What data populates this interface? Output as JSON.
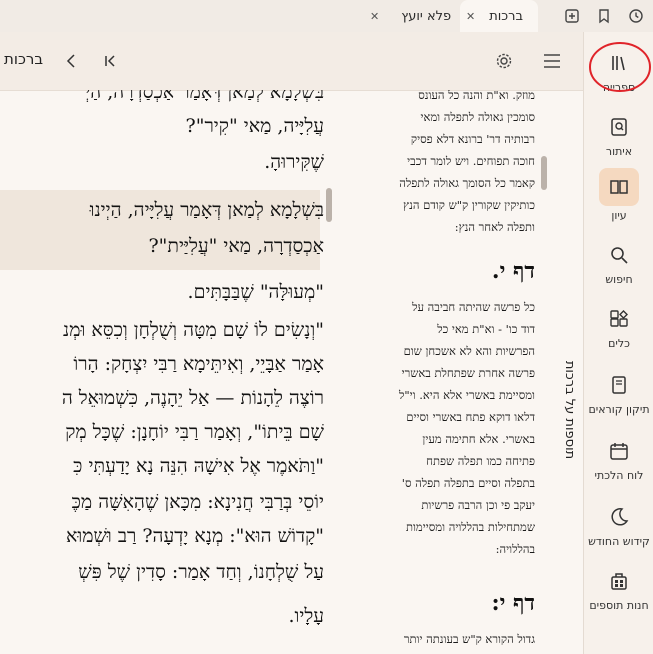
{
  "tabs": [
    {
      "title": "פלא יועץ"
    },
    {
      "title": "ברכות"
    }
  ],
  "toolbar": {
    "book_title": "ברכות"
  },
  "sidebar": {
    "items": [
      {
        "label": "ספרייה",
        "icon": "library-icon"
      },
      {
        "label": "איתור",
        "icon": "locate-icon"
      },
      {
        "label": "עיון",
        "icon": "open-book-icon"
      },
      {
        "label": "חיפוש",
        "icon": "search-icon"
      },
      {
        "label": "כלים",
        "icon": "tools-icon"
      },
      {
        "label": "תיקון קוראים",
        "icon": "scroll-book-icon"
      },
      {
        "label": "לוח הלכתי",
        "icon": "calendar-icon"
      },
      {
        "label": "קידוש החודש",
        "icon": "moon-icon"
      },
      {
        "label": "חנות תוספים",
        "icon": "store-icon"
      }
    ]
  },
  "commentary_panel": {
    "vertical_title": "תוספות על ברכות"
  },
  "main_text": {
    "lines": [
      "בִּשְׁלָמָא לְמַאן דְּאָמַר אַכְסַדְרָה, הַיְ",
      "עֲלִיָּיה, מַאי \"קִיר\"?",
      "שֶׁקִּירוּהָ.",
      "בִּשְׁלָמָא לְמַאן דְּאָמַר עֲלִיָּיה, הַיְינוּ",
      "אַכְסַדְרָה, מַאי \"עֲלִיַּית\"?",
      "\"מְעוּלָּה\" שֶׁבַּבָּתִּים.",
      "\"וְנָשִׂים לוֹ שָׁם מִטָּה וְשֻׁלְחָן וְכִסֵּא וּמְנ",
      "אָמַר אַבָּיֵי, וְאִיתֵּימָא רַבִּי יִצְחָק: הָרוֹ",
      "רוֹצֶה לֵהָנוֹת — אַל יֵהָנֶה, כִּשְׁמוּאֵל ה",
      "שָׁם בֵּיתוֹ\", וְאָמַר רַבִּי יוֹחָנָן: שֶׁכָּל מְק",
      "\"וַתֹּאמֶר אֶל אִישָׁהּ הִנֵּה נָא יָדַעְתִּי כִּ",
      "יוֹסֵי בְּרַבִּי חֲנִינָא: מִכָּאן שֶׁהָאִשָּׁה מַכֶּ",
      "\"קָדוֹשׁ הוּא\": מְנָא יָדְעָה? רַב וּשְׁמוּא",
      "עַל שֻׁלְחָנוֹ, וְחַד אָמַר: סָדִין שֶׁל פִּשְׁ",
      "עָלָיו."
    ]
  },
  "commentary": {
    "top_lines": [
      "מוזק. וא\"ת והנה כל העונס",
      "סומכין גאולה לתפלה ומאי",
      "רבותיה דר' ברונא דלא פסיק",
      "חוכה תפוחים. ויש לומר דכבי",
      "קאמר כל הסומך גאולה לתפלה",
      "כותיקין שקורין ק\"ש קודם הנץ",
      "ותפלה לאחר הנץ:"
    ],
    "daf1": "דף י.",
    "mid_lines": [
      "כל פרשה שהיתה חביבה על",
      "דוד כו' - וא\"ת מאי כל",
      "הפרשיות והא לא אשכחן שום",
      "פרשה אחרת שפתחלת באשרי",
      "ומסיימת באשרי אלא היא. וי\"ל",
      "דלאו דוקא פתח באשרי וסיים",
      "באשרי. אלא חתימה מעין",
      "פתיחה כמו תפלה שפתח",
      "בתפלה וסיים בתפלה תפלה ס'",
      "יעקב פי וכן הרבה פרשיות",
      "שמתחילות בהללויה ומסיימות",
      "בהללויה:"
    ],
    "daf2": "דף י:",
    "bottom_lines": [
      "גדול הקורא ק\"ש בעונתה יותר"
    ]
  },
  "colors": {
    "accent": "#f5d9c0",
    "background": "#faf6f2",
    "highlight": "#efe6dc",
    "annotation_circle": "#e0242a"
  }
}
